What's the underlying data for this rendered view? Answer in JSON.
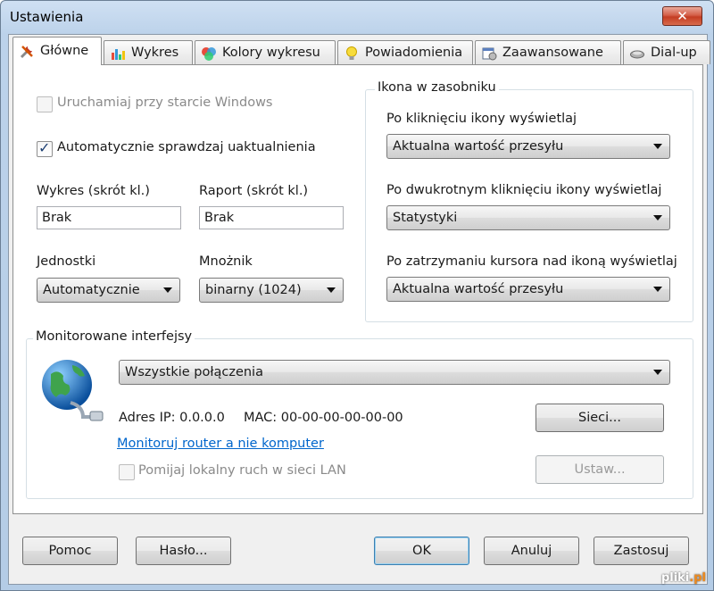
{
  "window": {
    "title": "Ustawienia",
    "close_glyph": "✕"
  },
  "tabs": [
    {
      "label": "Główne",
      "icon": "tools-icon"
    },
    {
      "label": "Wykres",
      "icon": "bar-chart-icon"
    },
    {
      "label": "Kolory wykresu",
      "icon": "palette-icon"
    },
    {
      "label": "Powiadomienia",
      "icon": "lightbulb-icon"
    },
    {
      "label": "Zaawansowane",
      "icon": "settings-calendar-icon"
    },
    {
      "label": "Dial-up",
      "icon": "modem-icon"
    }
  ],
  "general": {
    "startup": {
      "label": "Uruchamiaj przy starcie Windows",
      "checked": false,
      "enabled": false
    },
    "updates": {
      "label": "Automatycznie sprawdzaj uaktualnienia",
      "checked": true
    },
    "chart_shortcut": {
      "label": "Wykres (skrót kl.)",
      "value": "Brak"
    },
    "report_shortcut": {
      "label": "Raport (skrót kl.)",
      "value": "Brak"
    },
    "units": {
      "label": "Jednostki",
      "value": "Automatycznie"
    },
    "multiplier": {
      "label": "Mnożnik",
      "value": "binarny (1024)"
    }
  },
  "tray": {
    "legend": "Ikona w zasobniku",
    "click": {
      "label": "Po kliknięciu ikony wyświetlaj",
      "value": "Aktualna wartość przesyłu"
    },
    "dblclick": {
      "label": "Po dwukrotnym kliknięciu ikony wyświetlaj",
      "value": "Statystyki"
    },
    "hover": {
      "label": "Po zatrzymaniu kursora nad ikoną wyświetlaj",
      "value": "Aktualna wartość przesyłu"
    }
  },
  "interfaces": {
    "legend": "Monitorowane interfejsy",
    "selected": "Wszystkie połączenia",
    "ip_text": "Adres IP: 0.0.0.0",
    "mac_text": "MAC: 00-00-00-00-00-00",
    "networks_button": "Sieci...",
    "router_link": "Monitoruj router a nie komputer",
    "ignore_lan": {
      "label": "Pomijaj lokalny ruch w sieci LAN",
      "checked": false,
      "enabled": false
    },
    "set_button": "Ustaw..."
  },
  "buttons": {
    "help": "Pomoc",
    "password": "Hasło...",
    "ok": "OK",
    "cancel": "Anuluj",
    "apply": "Zastosuj"
  },
  "watermark": {
    "brand": "pliki",
    "tld": ".pl"
  }
}
